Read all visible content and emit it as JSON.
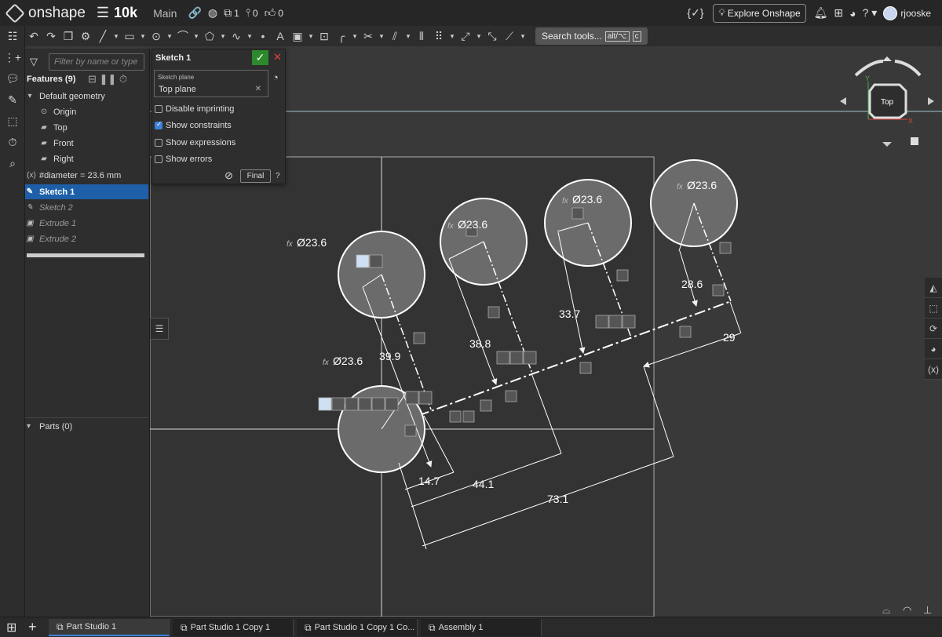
{
  "header": {
    "logo_text": "onshape",
    "doc_name": "10k",
    "branch": "Main",
    "versions_count": "1",
    "branches_count": "0",
    "likes_count": "0",
    "explore_label": "Explore Onshape",
    "username": "rjooske"
  },
  "toolbar": {
    "search_label": "Search tools...",
    "search_shortcut_1": "alt/⌥",
    "search_shortcut_2": "c"
  },
  "feature_panel": {
    "filter_placeholder": "Filter by name or type",
    "header": "Features (9)",
    "items": [
      {
        "label": "Default geometry",
        "type": "group"
      },
      {
        "label": "Origin",
        "type": "origin"
      },
      {
        "label": "Top",
        "type": "plane"
      },
      {
        "label": "Front",
        "type": "plane"
      },
      {
        "label": "Right",
        "type": "plane"
      },
      {
        "label": "#diameter = 23.6 mm",
        "type": "variable"
      },
      {
        "label": "Sketch 1",
        "type": "sketch",
        "selected": true
      },
      {
        "label": "Sketch 2",
        "type": "sketch"
      },
      {
        "label": "Extrude 1",
        "type": "extrude"
      },
      {
        "label": "Extrude 2",
        "type": "extrude"
      }
    ],
    "parts_label": "Parts (0)"
  },
  "sketch_dialog": {
    "title": "Sketch 1",
    "plane_label": "Sketch plane",
    "plane_value": "Top plane",
    "options": [
      {
        "label": "Disable imprinting",
        "checked": false
      },
      {
        "label": "Show constraints",
        "checked": true
      },
      {
        "label": "Show expressions",
        "checked": false
      },
      {
        "label": "Show errors",
        "checked": false
      }
    ],
    "final_label": "Final"
  },
  "viewcube": {
    "face_label": "Top",
    "y_label": "Y",
    "x_label": "X"
  },
  "sketch": {
    "diameter_labels": [
      "Ø23.6",
      "Ø23.6",
      "Ø23.6",
      "Ø23.6",
      "Ø23.6"
    ],
    "fx_label": "fx",
    "dimensions": [
      "39.9",
      "38.8",
      "33.7",
      "28.6",
      "29",
      "14.7",
      "44.1",
      "73.1"
    ]
  },
  "tabs": [
    {
      "label": "Part Studio 1",
      "active": true
    },
    {
      "label": "Part Studio 1 Copy 1",
      "active": false
    },
    {
      "label": "Part Studio 1 Copy 1 Co...",
      "active": false
    },
    {
      "label": "Assembly 1",
      "active": false
    }
  ],
  "colors": {
    "accent": "#1d5fa8",
    "ok_green": "#2c8a2c",
    "close_red": "#e04040",
    "sketch_fill": "#6b6b6b",
    "viewport_bg": "#393939"
  }
}
